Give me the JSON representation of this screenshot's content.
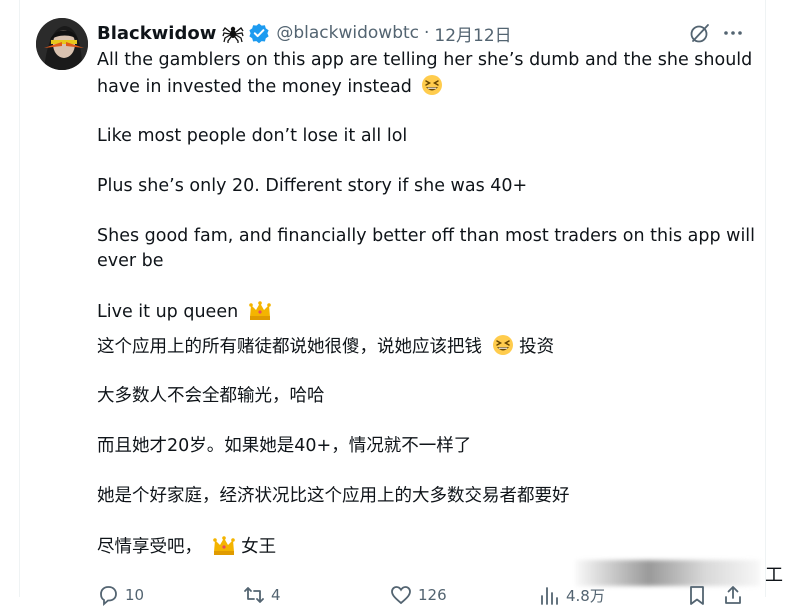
{
  "tweet": {
    "display_name": "Blackwidow",
    "handle": "@blackwidowbtc",
    "separator": "·",
    "date": "12月12日",
    "lines": [
      "All the gamblers on this app are telling her she’s dumb and the she should",
      "have in invested the money instead",
      "Like most people don’t lose it all lol",
      "Plus she’s only 20. Different story if she was 40+",
      "Shes good fam, and financially better off than most traders on this app will",
      "ever be",
      "Live it up queen"
    ],
    "translation": {
      "line1_before": "这个应用上的所有赌徒都说她很傻，说她应该把钱",
      "line1_after": "投资",
      "line2": "大多数人不会全都输光，哈哈",
      "line3": "而且她才20岁。如果她是40+，情况就不一样了",
      "line4": "她是个好家庭，经济状况比这个应用上的大多数交易者都要好",
      "line5_before": "尽情享受吧，",
      "line5_after": "女王"
    }
  },
  "actions": {
    "replies": "10",
    "reposts": "4",
    "likes": "126",
    "views": "4.8万"
  },
  "overlay": {
    "mark": "工"
  },
  "icons": [
    "spider-icon",
    "verified-icon",
    "grok-icon",
    "more-icon",
    "laughing-emoji",
    "crown-emoji",
    "reply-icon",
    "repost-icon",
    "like-icon",
    "views-icon",
    "bookmark-icon",
    "share-icon"
  ],
  "colors": {
    "verified": "#1d9bf0",
    "secondary_text": "#536471",
    "primary_text": "#0f1419"
  }
}
